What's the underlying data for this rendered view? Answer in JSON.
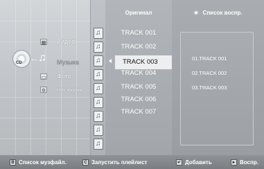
{
  "menu": {
    "disc_label": "CD",
    "items": [
      {
        "label": "Видео",
        "icon": "film-icon"
      },
      {
        "label": "Музыка",
        "icon": "music-note-icon"
      },
      {
        "label": "Фото",
        "icon": "photo-icon"
      },
      {
        "label": "Настройки",
        "icon": "gear-icon"
      }
    ]
  },
  "original": {
    "header": "Оригинал",
    "tracks": [
      "TRACK 001",
      "TRACK 002",
      "TRACK 003",
      "TRACK 004",
      "TRACK 005",
      "TRACK 006",
      "TRACK 007"
    ],
    "selected_index": 2
  },
  "playlist": {
    "star": "★",
    "header": "Список воспр.",
    "items": [
      "01.TRACK 001",
      "02.TRACK 002",
      "03.TRACK 003"
    ]
  },
  "bottom_bar": {
    "items": [
      {
        "key": "B",
        "label": "Список музфайл."
      },
      {
        "key": "C",
        "label": "Запустить плейлист"
      },
      {
        "key": "↵",
        "label": "Добавить"
      },
      {
        "key": "►",
        "label": "Воспр."
      }
    ]
  },
  "colors": {
    "selected_row_bg": "#eceeef",
    "panel_gray": "#b2b6ba",
    "text_white": "#ffffff"
  }
}
